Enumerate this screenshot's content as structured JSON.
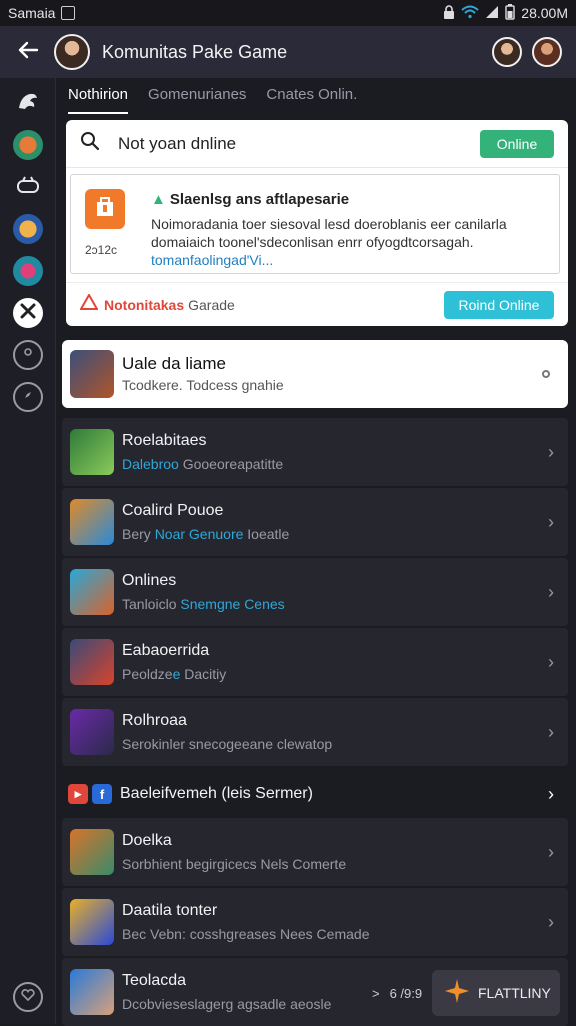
{
  "status_bar": {
    "carrier": "Samaia",
    "time": "28.00M"
  },
  "header": {
    "title": "Komunitas Pake Game",
    "back_icon": "arrow-left-icon"
  },
  "tabs": [
    {
      "label": "Nothirion",
      "active": true
    },
    {
      "label": "Gomenurianes",
      "active": false
    },
    {
      "label": "Cnates Onlin.",
      "active": false
    }
  ],
  "search_card": {
    "search_text": "Not yoan dnline",
    "online_button": "Online",
    "inner_title": "Slaenlsg ans aftlapesarie",
    "inner_desc": "Noimoradania toer siesoval lesd doeroblanis eer canilarla domaiaich toonel'sdeconlisan enrr ofyogdtcorsagah.",
    "inner_link": "tomanfaolingad'Vi...",
    "inner_version": "2ɔ12c",
    "footer_brand": "Notonitakas",
    "footer_sub": "Garade",
    "round_button": "Roind Online"
  },
  "featured": {
    "title": "Uale da liame",
    "subtitle": "Tcodkere. Todcess gnahie"
  },
  "rows": [
    {
      "title": "Roelabitaes",
      "sub_hl": "Dalebroo",
      "sub_rest": " Gooeoreapatitte",
      "hl_first": true
    },
    {
      "title": "Coalird Pouoe",
      "sub_pre": "Bery ",
      "sub_hl": "Noar Genuore",
      "sub_rest": " Ioeatle"
    },
    {
      "title": "Onlines",
      "sub_pre": "Tanloiclo ",
      "sub_hl": "Snemgne Cenes",
      "sub_rest": ""
    },
    {
      "title": "Eabaoerrida",
      "sub_pre": "Peoldze",
      "sub_hl": "",
      "sub_rest": " Dacitiy"
    },
    {
      "title": "Rolhroaa",
      "sub_pre": "Serokinler snecogeeane clewatop",
      "sub_hl": "",
      "sub_rest": ""
    }
  ],
  "section": {
    "title": "Baeleifvemeh (leis Sermer)"
  },
  "bottom_rows": [
    {
      "title": "Doelka",
      "sub": "Sorbhient begirgicecs Nels Comerte"
    },
    {
      "title": "Daatila tonter",
      "sub": "Bec Vebn: cosshgreases Nees Cemade"
    },
    {
      "title": "Teolacda",
      "sub": "Dcobvieseslagerg agsadle aeosle"
    }
  ],
  "pager": {
    "prev": ">",
    "page": "6 /9:9"
  },
  "promo": {
    "label": "FLATTLINY"
  },
  "colors": {
    "accent_green": "#33b37a",
    "accent_cyan": "#2ec0d6",
    "link_blue": "#2ea8d8",
    "brand_red": "#e0473a"
  }
}
